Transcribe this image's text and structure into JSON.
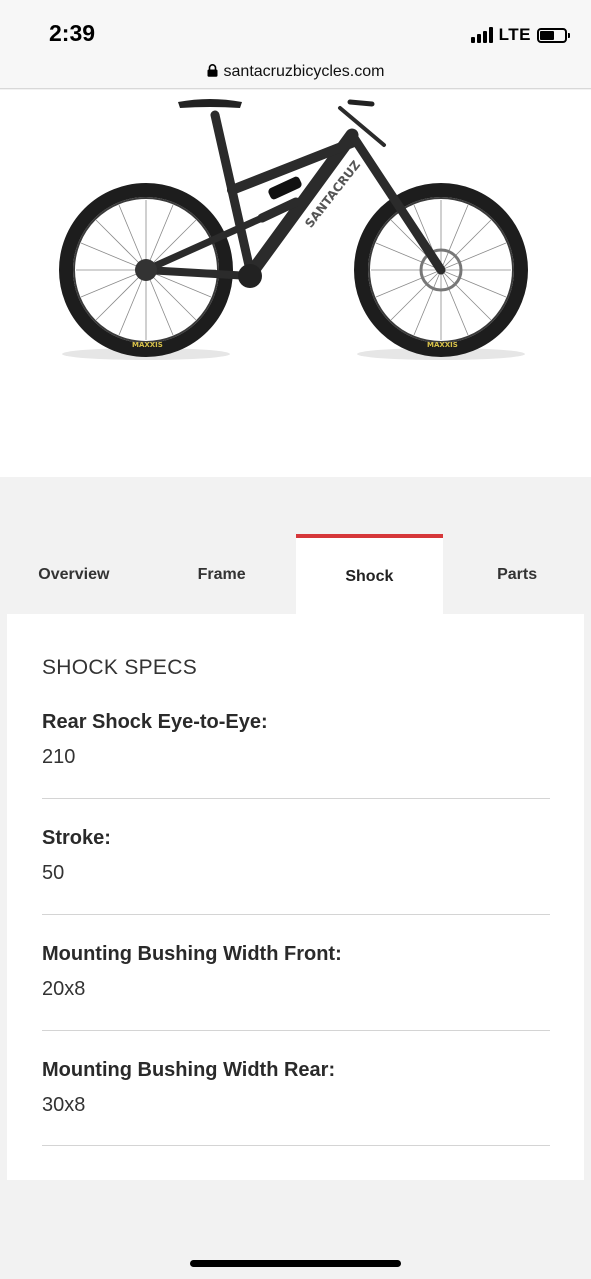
{
  "status_bar": {
    "time": "2:39",
    "network": "LTE",
    "battery_level": 0.6
  },
  "browser": {
    "url": "santacruzbicycles.com"
  },
  "hero": {
    "image": "bike-image"
  },
  "tabs": [
    {
      "label": "Overview",
      "active": false
    },
    {
      "label": "Frame",
      "active": false
    },
    {
      "label": "Shock",
      "active": true
    },
    {
      "label": "Parts",
      "active": false
    }
  ],
  "specs": {
    "title": "SHOCK SPECS",
    "items": [
      {
        "label": "Rear Shock Eye-to-Eye:",
        "value": "210"
      },
      {
        "label": "Stroke:",
        "value": "50"
      },
      {
        "label": "Mounting Bushing Width Front:",
        "value": "20x8"
      },
      {
        "label": "Mounting Bushing Width Rear:",
        "value": "30x8"
      }
    ]
  },
  "colors": {
    "accent": "#d6373a",
    "background": "#f2f2f2",
    "card": "#ffffff"
  }
}
